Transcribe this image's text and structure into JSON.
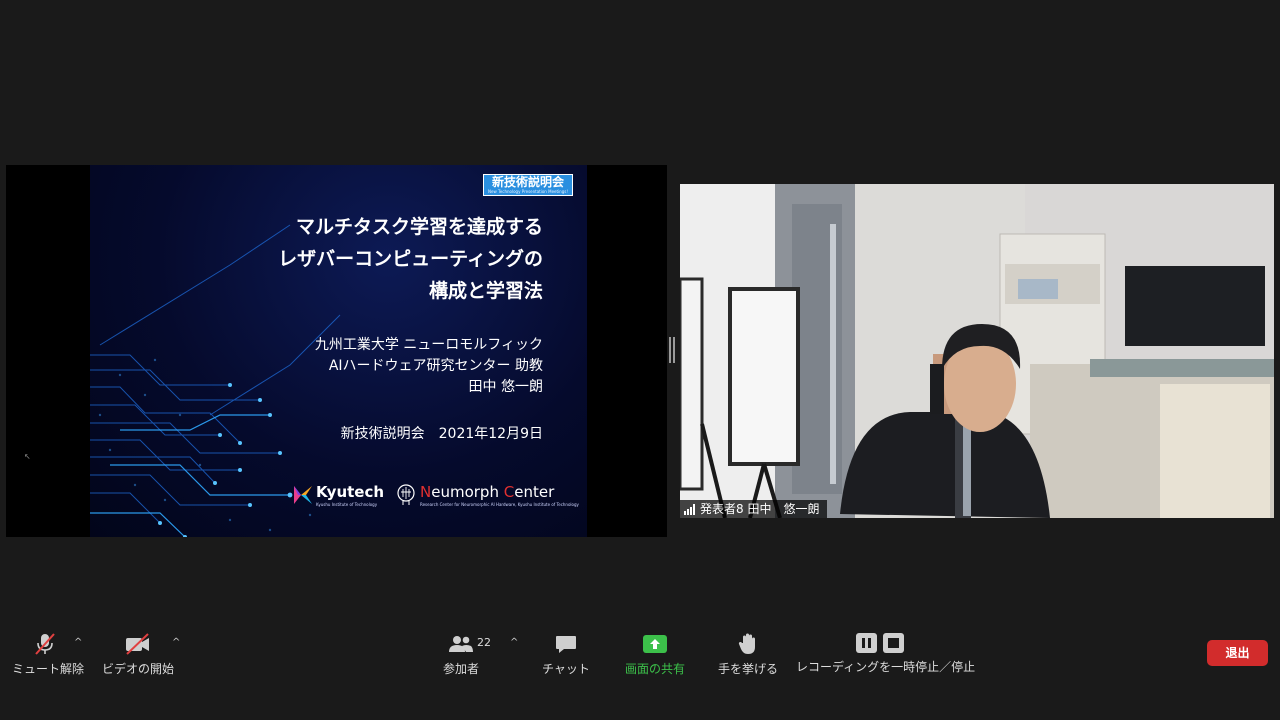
{
  "slide": {
    "badge_title": "新技術説明会",
    "badge_sub": "New Technology Presentation Meetings!",
    "title_lines": [
      "マルチタスク学習を達成する",
      "レザバーコンピューティングの",
      "構成と学習法"
    ],
    "affiliation_lines": [
      "九州工業大学 ニューロモルフィック",
      "AIハードウェア研究センター 助教",
      "田中 悠一朗"
    ],
    "event_line": "新技術説明会　2021年12月9日",
    "logo_kyutech": "Kyutech",
    "logo_kyutech_sub": "Kyushu Institute of Technology",
    "logo_neumorph_n": "N",
    "logo_neumorph_mid": "eumorph ",
    "logo_neumorph_c": "C",
    "logo_neumorph_end": "enter",
    "logo_neumorph_sub": "Research Center for Neuromorphic AI Hardware, Kyushu Institute of Technology"
  },
  "video": {
    "participant_label": "発表者8 田中　悠一朗"
  },
  "toolbar": {
    "mute_label": "ミュート解除",
    "video_label": "ビデオの開始",
    "participants_label": "参加者",
    "participants_count": "22",
    "chat_label": "チャット",
    "share_label": "画面の共有",
    "raise_hand_label": "手を挙げる",
    "recording_label": "レコーディングを一時停止／停止",
    "leave_label": "退出"
  },
  "colors": {
    "background": "#1a1a1a",
    "share_green": "#3cc04a",
    "leave_red": "#d22c2c",
    "mute_red": "#e04040"
  },
  "icons": [
    "microphone-muted-icon",
    "video-off-icon",
    "participants-icon",
    "chat-icon",
    "share-screen-icon",
    "raise-hand-icon",
    "pause-icon",
    "stop-icon",
    "signal-icon"
  ]
}
